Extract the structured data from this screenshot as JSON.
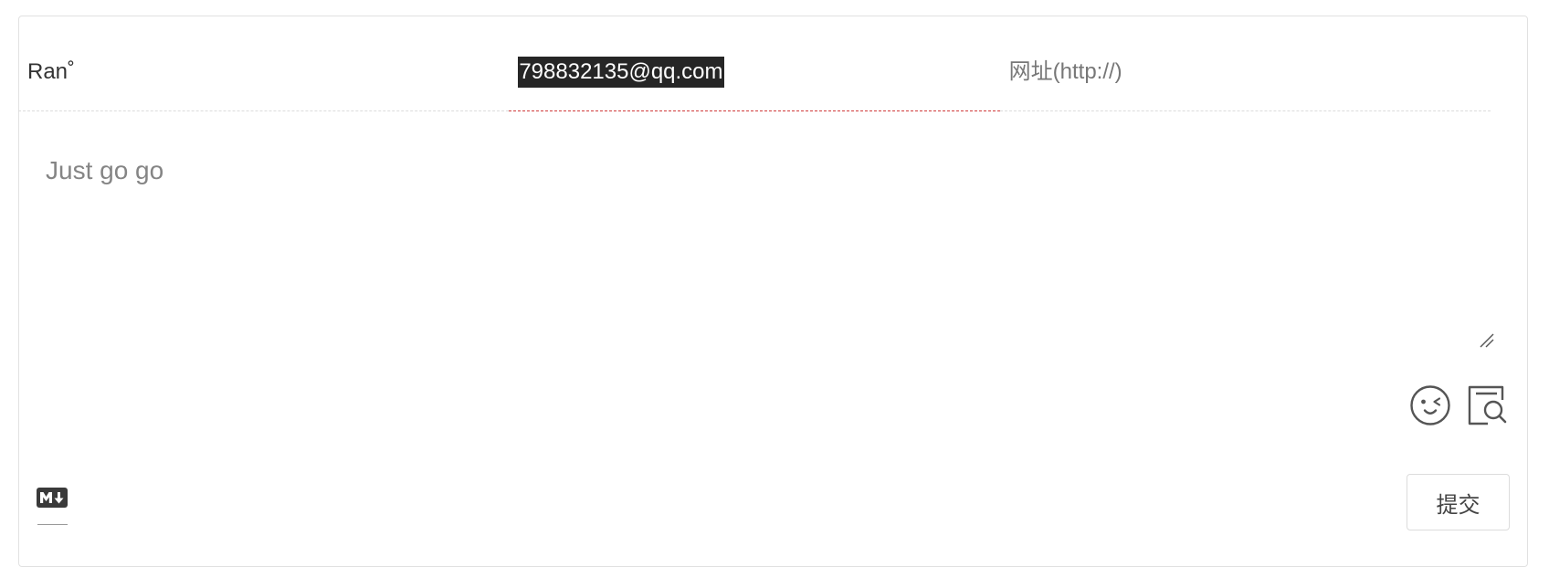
{
  "form": {
    "nick": {
      "value": "Ran˚"
    },
    "mail": {
      "value": "798832135@qq.com",
      "selected": true
    },
    "link": {
      "placeholder": "网址(http://)"
    },
    "comment": {
      "value": "Just go go"
    }
  },
  "tools": {
    "emoji_icon": "wink-face-icon",
    "preview_icon": "preview-search-icon",
    "markdown_icon": "markdown-icon"
  },
  "submit_label": "提交",
  "colors": {
    "active_underline": "#d03a3a",
    "selection_bg": "#262626",
    "border": "#e1e1e1"
  }
}
